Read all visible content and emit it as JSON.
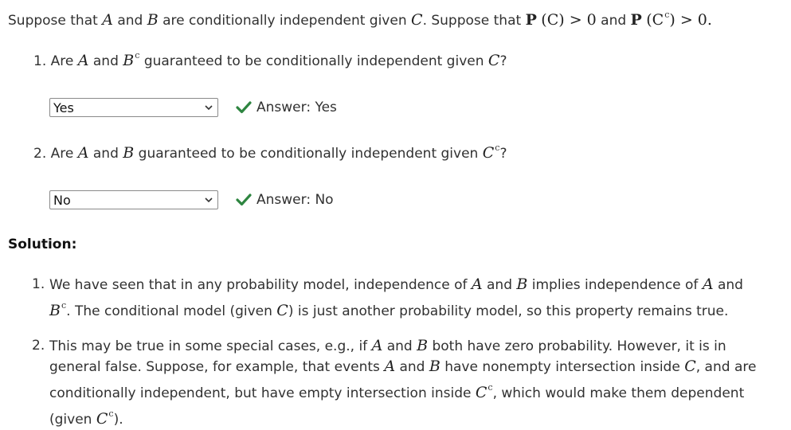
{
  "intro": {
    "t1": "Suppose that ",
    "A": "A",
    "and1": " and ",
    "B": "B",
    "t2": " are conditionally independent given ",
    "C": "C",
    "t3": ". Suppose that ",
    "P1": "P",
    "pc1": "(C)",
    "gt1": " > 0",
    "and2": " and ",
    "P2": "P",
    "pc2_open": "(C",
    "pc2_sup": "c",
    "pc2_close": ")",
    "gt2": " > 0."
  },
  "q1": {
    "num": "1.",
    "t1": " Are ",
    "A": "A",
    "and": " and ",
    "B": "B",
    "sup": "c",
    "t2": " guaranteed to be conditionally independent given ",
    "C": "C",
    "q": "?",
    "selected": "Yes",
    "answer": "Answer: Yes"
  },
  "q2": {
    "num": "2.",
    "t1": " Are ",
    "A": "A",
    "and": " and ",
    "B": "B",
    "t2": " guaranteed to be conditionally independent given ",
    "C": "C",
    "sup": "c",
    "q": "?",
    "selected": "No",
    "answer": "Answer: No"
  },
  "solution": {
    "title": "Solution:",
    "s1": {
      "num": "1.",
      "a": "We have seen that in any probability model, independence of ",
      "A": "A",
      "b": " and ",
      "B": "B",
      "c": " implies independence of ",
      "A2": "A",
      "d": " and",
      "B2": "B",
      "sup": "c",
      "e": ". The conditional model (given ",
      "C": "C",
      "f": ") is just another probability model, so this property remains true."
    },
    "s2": {
      "num": "2.",
      "a": "This may be true in some special cases, e.g., if ",
      "A": "A",
      "b": " and ",
      "B": "B",
      "c": " both have zero probability. However, it is in",
      "d": "general false. Suppose, for example, that events ",
      "A2": "A",
      "e": " and ",
      "B2": "B",
      "f": " have nonempty intersection inside ",
      "C": "C",
      "g": ", and are",
      "h": "conditionally independent, but have empty intersection inside ",
      "C2": "C",
      "sup": "c",
      "i": ", which would make them dependent",
      "j": "(given ",
      "C3": "C",
      "sup2": "c",
      "k": ")."
    }
  },
  "colors": {
    "check": "#2e8540",
    "text": "#313131"
  },
  "icons": {
    "check": "check-icon",
    "chevron": "chevron-down-icon"
  }
}
